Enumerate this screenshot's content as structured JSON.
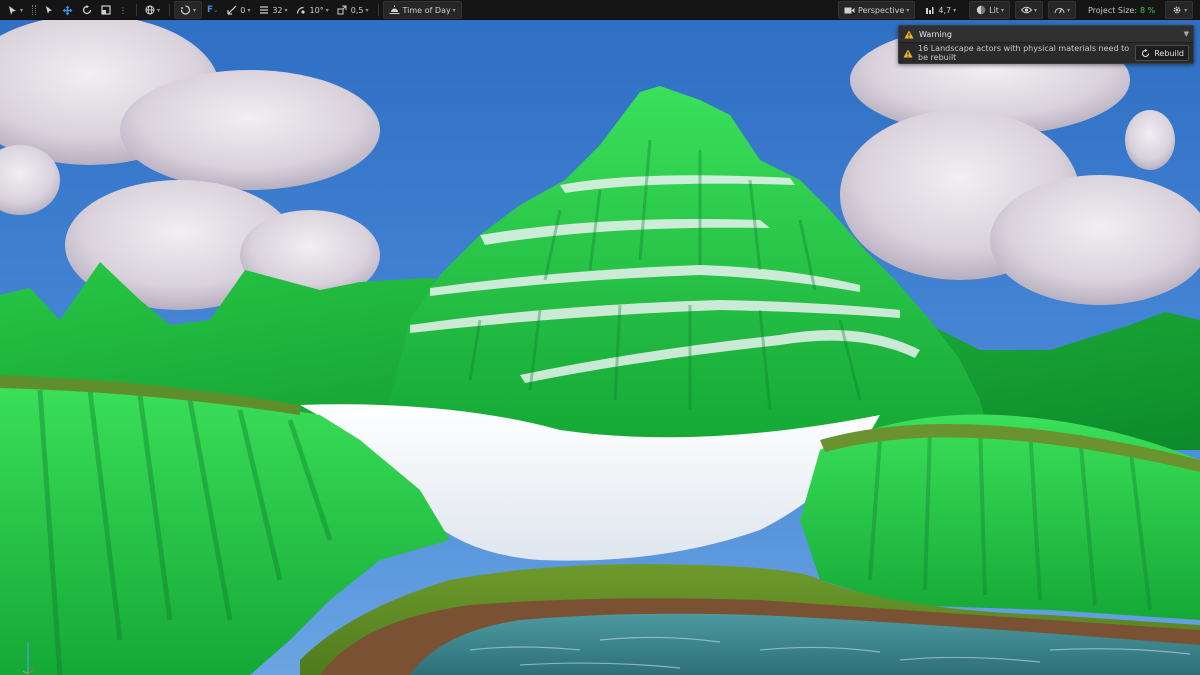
{
  "toolbar": {
    "grid_translate_value": "0",
    "grid_size_value": "32",
    "rotation_snap_value": "10°",
    "scale_snap_value": "0,5",
    "time_of_day_label": "Time of Day",
    "view_mode_label": "Perspective",
    "camera_speed_value": "4,7",
    "lighting_label": "Lit",
    "project_size_label": "Project Size:",
    "project_size_value": "8 %"
  },
  "warning": {
    "title": "Warning",
    "message": "16 Landscape actors with physical materials need to be rebuilt",
    "rebuild_label": "Rebuild"
  },
  "icons": {
    "toolbar": [
      "select-mode-icon",
      "arrow-cursor-icon",
      "translate-icon",
      "rotate-icon",
      "scale-icon",
      "world-icon",
      "surface-snap-icon",
      "grid-icon",
      "angle-icon",
      "scale-snap-icon",
      "time-of-day-icon",
      "camera-icon",
      "sphere-icon",
      "eye-icon",
      "speed-icon",
      "gear-icon"
    ],
    "warning": [
      "warning-icon",
      "refresh-icon",
      "chevron-down-icon"
    ]
  },
  "colors": {
    "toolbar_bg": "#151515",
    "warning_yellow": "#f0b429",
    "project_size_green": "#34d13a",
    "mountain_green": "#2fd24a",
    "sky_blue": "#3f7fcf"
  }
}
